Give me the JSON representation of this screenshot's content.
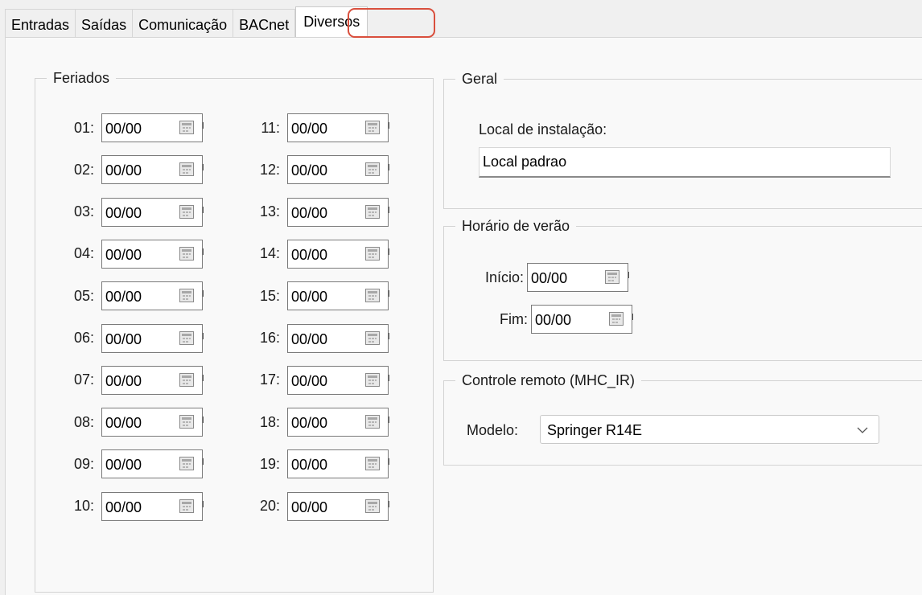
{
  "tabs": [
    {
      "label": "Entradas"
    },
    {
      "label": "Saídas"
    },
    {
      "label": "Comunicação"
    },
    {
      "label": "BACnet"
    },
    {
      "label": "Diversos"
    }
  ],
  "active_tab": "Diversos",
  "highlight_color": "#d94f3d",
  "feriados": {
    "title": "Feriados",
    "left": [
      {
        "label": "01:",
        "value": "00/00"
      },
      {
        "label": "02:",
        "value": "00/00"
      },
      {
        "label": "03:",
        "value": "00/00"
      },
      {
        "label": "04:",
        "value": "00/00"
      },
      {
        "label": "05:",
        "value": "00/00"
      },
      {
        "label": "06:",
        "value": "00/00"
      },
      {
        "label": "07:",
        "value": "00/00"
      },
      {
        "label": "08:",
        "value": "00/00"
      },
      {
        "label": "09:",
        "value": "00/00"
      },
      {
        "label": "10:",
        "value": "00/00"
      }
    ],
    "right": [
      {
        "label": "11:",
        "value": "00/00"
      },
      {
        "label": "12:",
        "value": "00/00"
      },
      {
        "label": "13:",
        "value": "00/00"
      },
      {
        "label": "14:",
        "value": "00/00"
      },
      {
        "label": "15:",
        "value": "00/00"
      },
      {
        "label": "16:",
        "value": "00/00"
      },
      {
        "label": "17:",
        "value": "00/00"
      },
      {
        "label": "18:",
        "value": "00/00"
      },
      {
        "label": "19:",
        "value": "00/00"
      },
      {
        "label": "20:",
        "value": "00/00"
      }
    ]
  },
  "geral": {
    "title": "Geral",
    "local_label": "Local de instalação:",
    "local_value": "Local padrao"
  },
  "horario": {
    "title": "Horário de verão",
    "inicio_label": "Início:",
    "inicio_value": "00/00",
    "fim_label": "Fim:",
    "fim_value": "00/00"
  },
  "controle": {
    "title": "Controle remoto (MHC_IR)",
    "modelo_label": "Modelo:",
    "modelo_value": "Springer R14E"
  }
}
